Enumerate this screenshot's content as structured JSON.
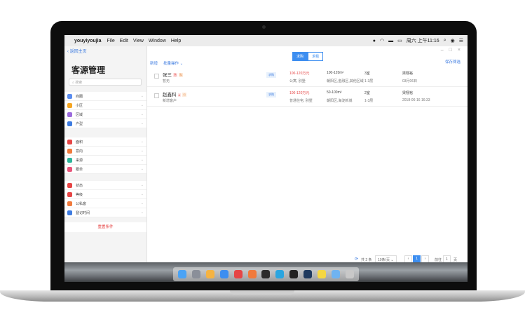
{
  "menubar": {
    "apple": "",
    "app_name": "youyiyoujia",
    "menus": [
      "File",
      "Edit",
      "View",
      "Window",
      "Help"
    ],
    "clock": "周六 上午11:16"
  },
  "window": {
    "controls": [
      "–",
      "□",
      "×"
    ]
  },
  "sidebar": {
    "back_label": "返回主页",
    "title": "客源管理",
    "search_placeholder": "搜索",
    "items": [
      {
        "label": "商圈",
        "icon": "location-icon",
        "color": "#5b8def"
      },
      {
        "label": "小区",
        "icon": "building-icon",
        "color": "#f5a623"
      },
      {
        "label": "区域",
        "icon": "area-icon",
        "color": "#9b6bdc"
      },
      {
        "label": "户型",
        "icon": "floorplan-icon",
        "color": "#3d7be0"
      },
      {
        "label": "面积",
        "icon": "size-icon",
        "color": "#e64545"
      },
      {
        "label": "意向",
        "icon": "intent-icon",
        "color": "#f07a3c"
      },
      {
        "label": "来源",
        "icon": "source-icon",
        "color": "#2bb59a"
      },
      {
        "label": "跟单",
        "icon": "follow-icon",
        "color": "#e8557a"
      },
      {
        "label": "状态",
        "icon": "status-icon",
        "color": "#e64545"
      },
      {
        "label": "等级",
        "icon": "level-icon",
        "color": "#e64545"
      },
      {
        "label": "公私客",
        "icon": "customer-icon",
        "color": "#f07a3c"
      },
      {
        "label": "登记时间",
        "icon": "clock-icon",
        "color": "#3d7be0"
      }
    ],
    "reset_label": "重置条件"
  },
  "main": {
    "segments": {
      "on": "求购",
      "off": "求租"
    },
    "toolbar": {
      "add": "新增",
      "batch": "批量操作"
    },
    "right_link": "保存筛选",
    "rows": [
      {
        "name": "张三",
        "tags": [
          "急",
          "私"
        ],
        "sub": "暂无",
        "badge": "求购",
        "price": "100-120万元",
        "price_sub": "公寓, 别墅",
        "area": "100-120m²",
        "area_sub": "朝阳区,金融区,其他区域",
        "rooms": "3室",
        "rooms_sub": "1-3层",
        "agent": "梁翔裕",
        "date": "03月06日"
      },
      {
        "name": "赵鑫科",
        "tags": [
          "A",
          "公"
        ],
        "sub": "新增客户",
        "badge": "求购",
        "price": "100-120万元",
        "price_sub": "普通住宅, 别墅",
        "area": "50-100m²",
        "area_sub": "朝阳区,海淀新城",
        "rooms": "2室",
        "rooms_sub": "1-3层",
        "agent": "梁翔裕",
        "date": "2018-06-16 16:33"
      }
    ],
    "pager": {
      "total": "共 2 条",
      "page_size": "10条/页",
      "prev": "‹",
      "current": "1",
      "next": "›",
      "goto_label": "前往",
      "goto_value": "1",
      "page_suffix": "页"
    }
  },
  "dock": {
    "icons": [
      {
        "name": "finder-icon",
        "color": "#4aa3f5"
      },
      {
        "name": "launchpad-icon",
        "color": "#8a8f99"
      },
      {
        "name": "photos-icon",
        "color": "#f5b342"
      },
      {
        "name": "safari-icon",
        "color": "#3d8ef0"
      },
      {
        "name": "chrome-icon",
        "color": "#e64545"
      },
      {
        "name": "firefox-icon",
        "color": "#f07a3c"
      },
      {
        "name": "qq-icon",
        "color": "#2b2b2b"
      },
      {
        "name": "skype-icon",
        "color": "#2aa5e0"
      },
      {
        "name": "terminal-icon",
        "color": "#222"
      },
      {
        "name": "photoshop-icon",
        "color": "#1e3a5f"
      },
      {
        "name": "notes-icon",
        "color": "#f5d742"
      },
      {
        "name": "folder-icon",
        "color": "#6fb3f0"
      },
      {
        "name": "trash-icon",
        "color": "#c8c8c8"
      }
    ]
  }
}
